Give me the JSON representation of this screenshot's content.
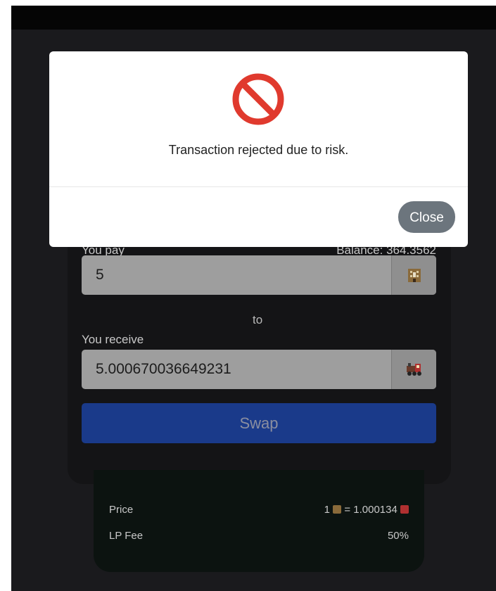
{
  "modal": {
    "icon": "prohibited-icon",
    "message": "Transaction rejected due to risk.",
    "close_label": "Close"
  },
  "swap": {
    "pay_label": "You pay",
    "balance_text": "Balance: 364.3562",
    "pay_value": "5",
    "pay_token_icon": "hotel-building-icon",
    "to_text": "to",
    "receive_label": "You receive",
    "receive_value": "5.000670036649231",
    "receive_token_icon": "locomotive-icon",
    "swap_label": "Swap"
  },
  "info": {
    "price_label": "Price",
    "price_left": "1",
    "price_right": "= 1.000134",
    "lp_fee_label": "LP Fee",
    "lp_fee_value": "50%"
  },
  "colors": {
    "background": "#1a1a1d",
    "swap_button": "#1a3a8a",
    "close_button": "#6c757d",
    "prohibited": "#e03a2e"
  }
}
